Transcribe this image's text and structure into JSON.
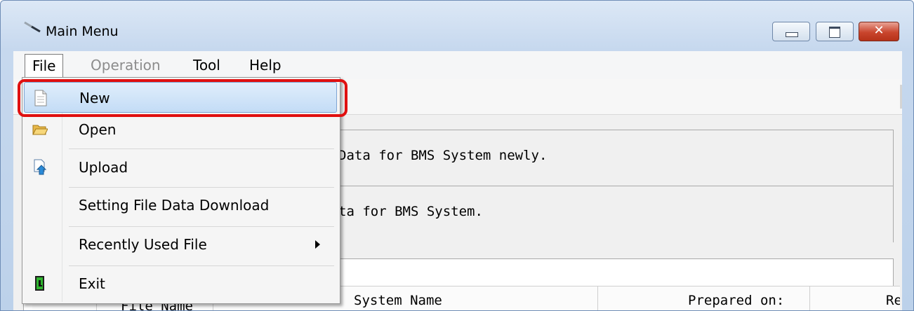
{
  "window": {
    "title": "Main Menu",
    "icon": "tool-icon",
    "buttons": {
      "minimize": "minimize-icon",
      "maximize": "maximize-icon",
      "close": "✕"
    }
  },
  "menubar": {
    "file": "File",
    "operation": "Operation",
    "tool": "Tool",
    "help": "Help"
  },
  "file_menu": {
    "items": [
      {
        "label": "New",
        "icon": "new-document-icon",
        "highlighted": true
      },
      {
        "label": "Open",
        "icon": "folder-open-icon"
      },
      {
        "label": "Upload",
        "icon": "upload-icon"
      },
      {
        "label": "Setting File Data Download"
      },
      {
        "label": "Recently Used File",
        "submenu": true
      },
      {
        "label": "Exit",
        "icon": "exit-icon"
      }
    ]
  },
  "groups": {
    "new_desc": "Data for BMS System newly.",
    "open_desc": "ta for BMS System."
  },
  "list": {
    "columns": [
      "File Name",
      "System Name",
      "Prepared on:",
      "Re"
    ]
  },
  "colors": {
    "highlight_outline": "#e01010",
    "selection": "#c3dcf6"
  }
}
